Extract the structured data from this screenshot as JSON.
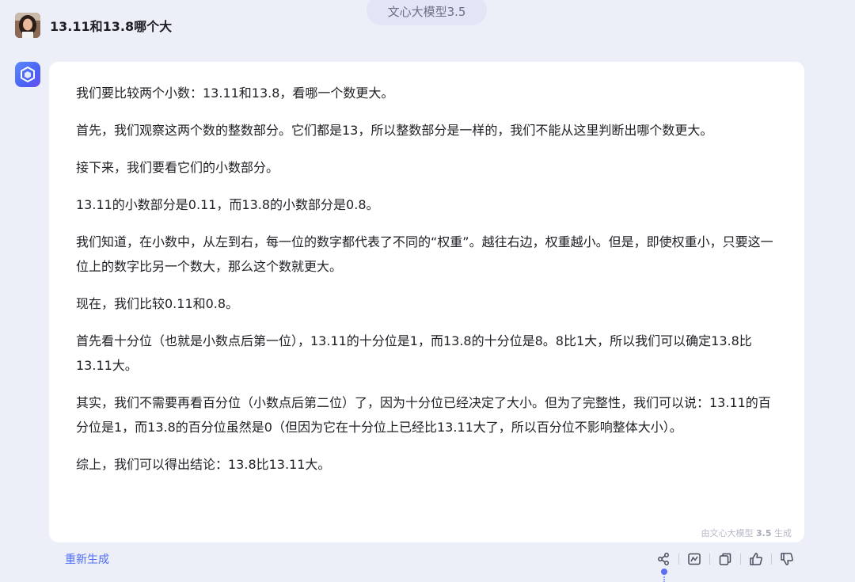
{
  "header": {
    "model_badge": "文心大模型3.5"
  },
  "user_message": {
    "avatar_icon": "user-avatar-photo",
    "text": "13.11和13.8哪个大"
  },
  "assistant": {
    "icon": "ernie-bot-cube-icon",
    "paragraphs": [
      "我们要比较两个小数：13.11和13.8，看哪一个数更大。",
      "首先，我们观察这两个数的整数部分。它们都是13，所以整数部分是一样的，我们不能从这里判断出哪个数更大。",
      "接下来，我们要看它们的小数部分。",
      "13.11的小数部分是0.11，而13.8的小数部分是0.8。",
      "我们知道，在小数中，从左到右，每一位的数字都代表了不同的“权重”。越往右边，权重越小。但是，即使权重小，只要这一位上的数字比另一个数大，那么这个数就更大。",
      "现在，我们比较0.11和0.8。",
      "首先看十分位（也就是小数点后第一位），13.11的十分位是1，而13.8的十分位是8。8比1大，所以我们可以确定13.8比13.11大。",
      "其实，我们不需要再看百分位（小数点后第二位）了，因为十分位已经决定了大小。但为了完整性，我们可以说：13.11的百分位是1，而13.8的百分位虽然是0（但因为它在十分位上已经比13.11大了，所以百分位不影响整体大小）。",
      "综上，我们可以得出结论：13.8比13.11大。"
    ],
    "generated_by_prefix": "由文心大模型",
    "generated_by_version": "3.5",
    "generated_by_suffix": "生成"
  },
  "footer": {
    "regenerate_label": "重新生成",
    "actions": [
      "share-icon",
      "chart-icon",
      "copy-icon",
      "thumbs-up-icon",
      "thumbs-down-icon"
    ]
  },
  "colors": {
    "background": "#eceef8",
    "accent": "#4e6ef2",
    "card": "#ffffff"
  }
}
